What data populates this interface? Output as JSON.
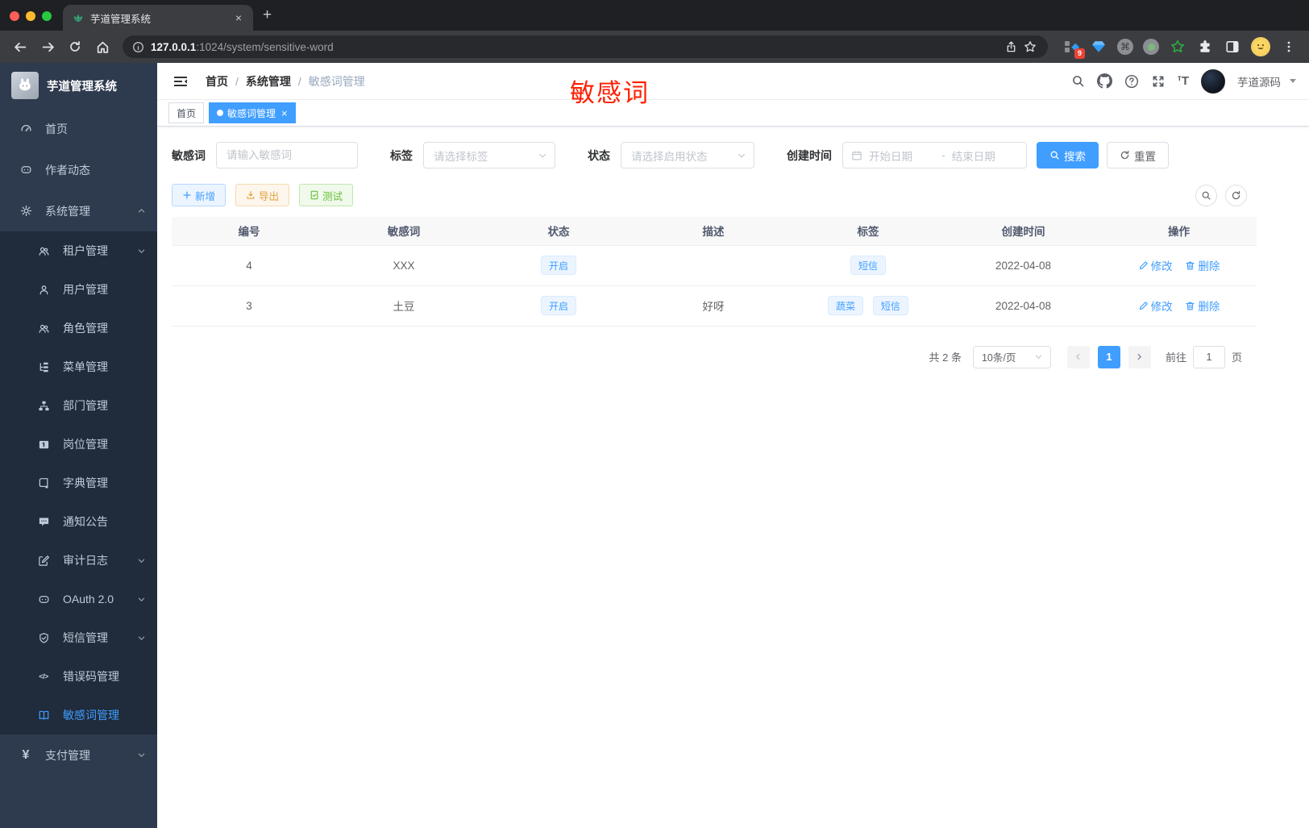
{
  "browser": {
    "tab_title": "芋道管理系统",
    "tab_close": "×",
    "new_tab": "+",
    "url_host": "127.0.0.1",
    "url_rest": ":1024/system/sensitive-word",
    "extensions_badge": "9",
    "cmd_glyph": "⌘"
  },
  "sidebar": {
    "logo_title": "芋道管理系统",
    "items": [
      {
        "label": "首页"
      },
      {
        "label": "作者动态"
      },
      {
        "label": "系统管理"
      },
      {
        "label": "租户管理"
      },
      {
        "label": "用户管理"
      },
      {
        "label": "角色管理"
      },
      {
        "label": "菜单管理"
      },
      {
        "label": "部门管理"
      },
      {
        "label": "岗位管理"
      },
      {
        "label": "字典管理"
      },
      {
        "label": "通知公告"
      },
      {
        "label": "审计日志"
      },
      {
        "label": "OAuth 2.0"
      },
      {
        "label": "短信管理"
      },
      {
        "label": "错误码管理"
      },
      {
        "label": "敏感词管理"
      },
      {
        "label": "支付管理"
      }
    ],
    "code_icon_text": "</>",
    "yen_icon_text": "¥"
  },
  "header": {
    "breadcrumb": {
      "home": "首页",
      "sep1": "/",
      "section": "系统管理",
      "sep2": "/",
      "current": "敏感词管理"
    },
    "annotation": "敏感词",
    "username": "芋道源码",
    "font_icon_small": "т",
    "font_icon_big": "T"
  },
  "tags": {
    "home": "首页",
    "active": "敏感词管理",
    "close": "×"
  },
  "filters": {
    "keyword_label": "敏感词",
    "keyword_placeholder": "请输入敏感词",
    "tag_label": "标签",
    "tag_placeholder": "请选择标签",
    "status_label": "状态",
    "status_placeholder": "请选择启用状态",
    "time_label": "创建时间",
    "start_placeholder": "开始日期",
    "range_separator": "-",
    "end_placeholder": "结束日期",
    "search_label": "搜索",
    "reset_label": "重置"
  },
  "toolbar": {
    "add": "新增",
    "export": "导出",
    "test": "测试"
  },
  "table": {
    "columns": [
      "编号",
      "敏感词",
      "状态",
      "描述",
      "标签",
      "创建时间",
      "操作"
    ],
    "rows": [
      {
        "id": "4",
        "word": "XXX",
        "status": "开启",
        "description": "",
        "tag1": "短信",
        "created": "2022-04-08",
        "edit": "修改",
        "delete": "删除"
      },
      {
        "id": "3",
        "word": "土豆",
        "status": "开启",
        "description": "好呀",
        "tag1": "蔬菜",
        "tag2": "短信",
        "created": "2022-04-08",
        "edit": "修改",
        "delete": "删除"
      }
    ]
  },
  "pagination": {
    "total": "共 2 条",
    "size": "10条/页",
    "page": "1",
    "goto": "前往",
    "goto_value": "1",
    "unit": "页"
  },
  "colors": {
    "accent": "#409eff",
    "annotation_red": "#ff1e00",
    "sidebar_bg": "#2e3b4e",
    "submenu_bg": "#202b3b"
  }
}
